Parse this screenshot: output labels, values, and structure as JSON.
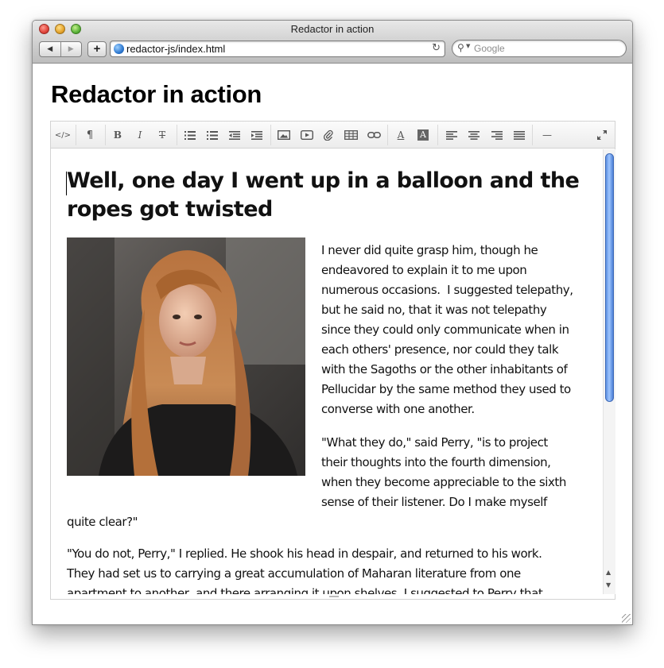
{
  "browser": {
    "window_title": "Redactor in action",
    "url": "redactor-js/index.html",
    "search_placeholder": "Google",
    "add_tab_label": "+"
  },
  "page": {
    "title": "Redactor in action"
  },
  "toolbar": {
    "html_label": "</>",
    "formatting_label": "¶",
    "bold_label": "B",
    "italic_label": "I",
    "deleted_label": "T",
    "fontcolor_label": "A",
    "backcolor_label": "A",
    "horizontalrule_label": "—"
  },
  "editor": {
    "heading": "Well, one day I went up in a balloon and the ropes got twisted",
    "paragraph1_lines": [
      "I never did quite grasp him, though he",
      "endeavored to explain it to me upon",
      "numerous occasions.  I suggested telepathy,",
      "but he said no, that it was not telepathy",
      "since they could only communicate when in",
      "each others' presence, nor could they talk",
      "with the Sagoths or the other inhabitants of",
      "Pellucidar by the same method they used to",
      "converse with one another."
    ],
    "paragraph2_lines": [
      "\"What they do,\" said Perry, \"is to project",
      "their thoughts into the fourth dimension,",
      "when they become appreciable to the sixth",
      "sense of their listener. Do I make myself",
      "quite clear?\""
    ],
    "paragraph3_lines": [
      "\"You do not, Perry,\" I replied. He shook his head in despair, and returned to his work.",
      "They had set us to carrying a great accumulation of Maharan literature from one",
      "apartment to another, and there arranging it upon shelves. I suggested to Perry that"
    ]
  },
  "colors": {
    "scroll_thumb": "#5c8ee0",
    "toolbar_icon": "#555555"
  }
}
